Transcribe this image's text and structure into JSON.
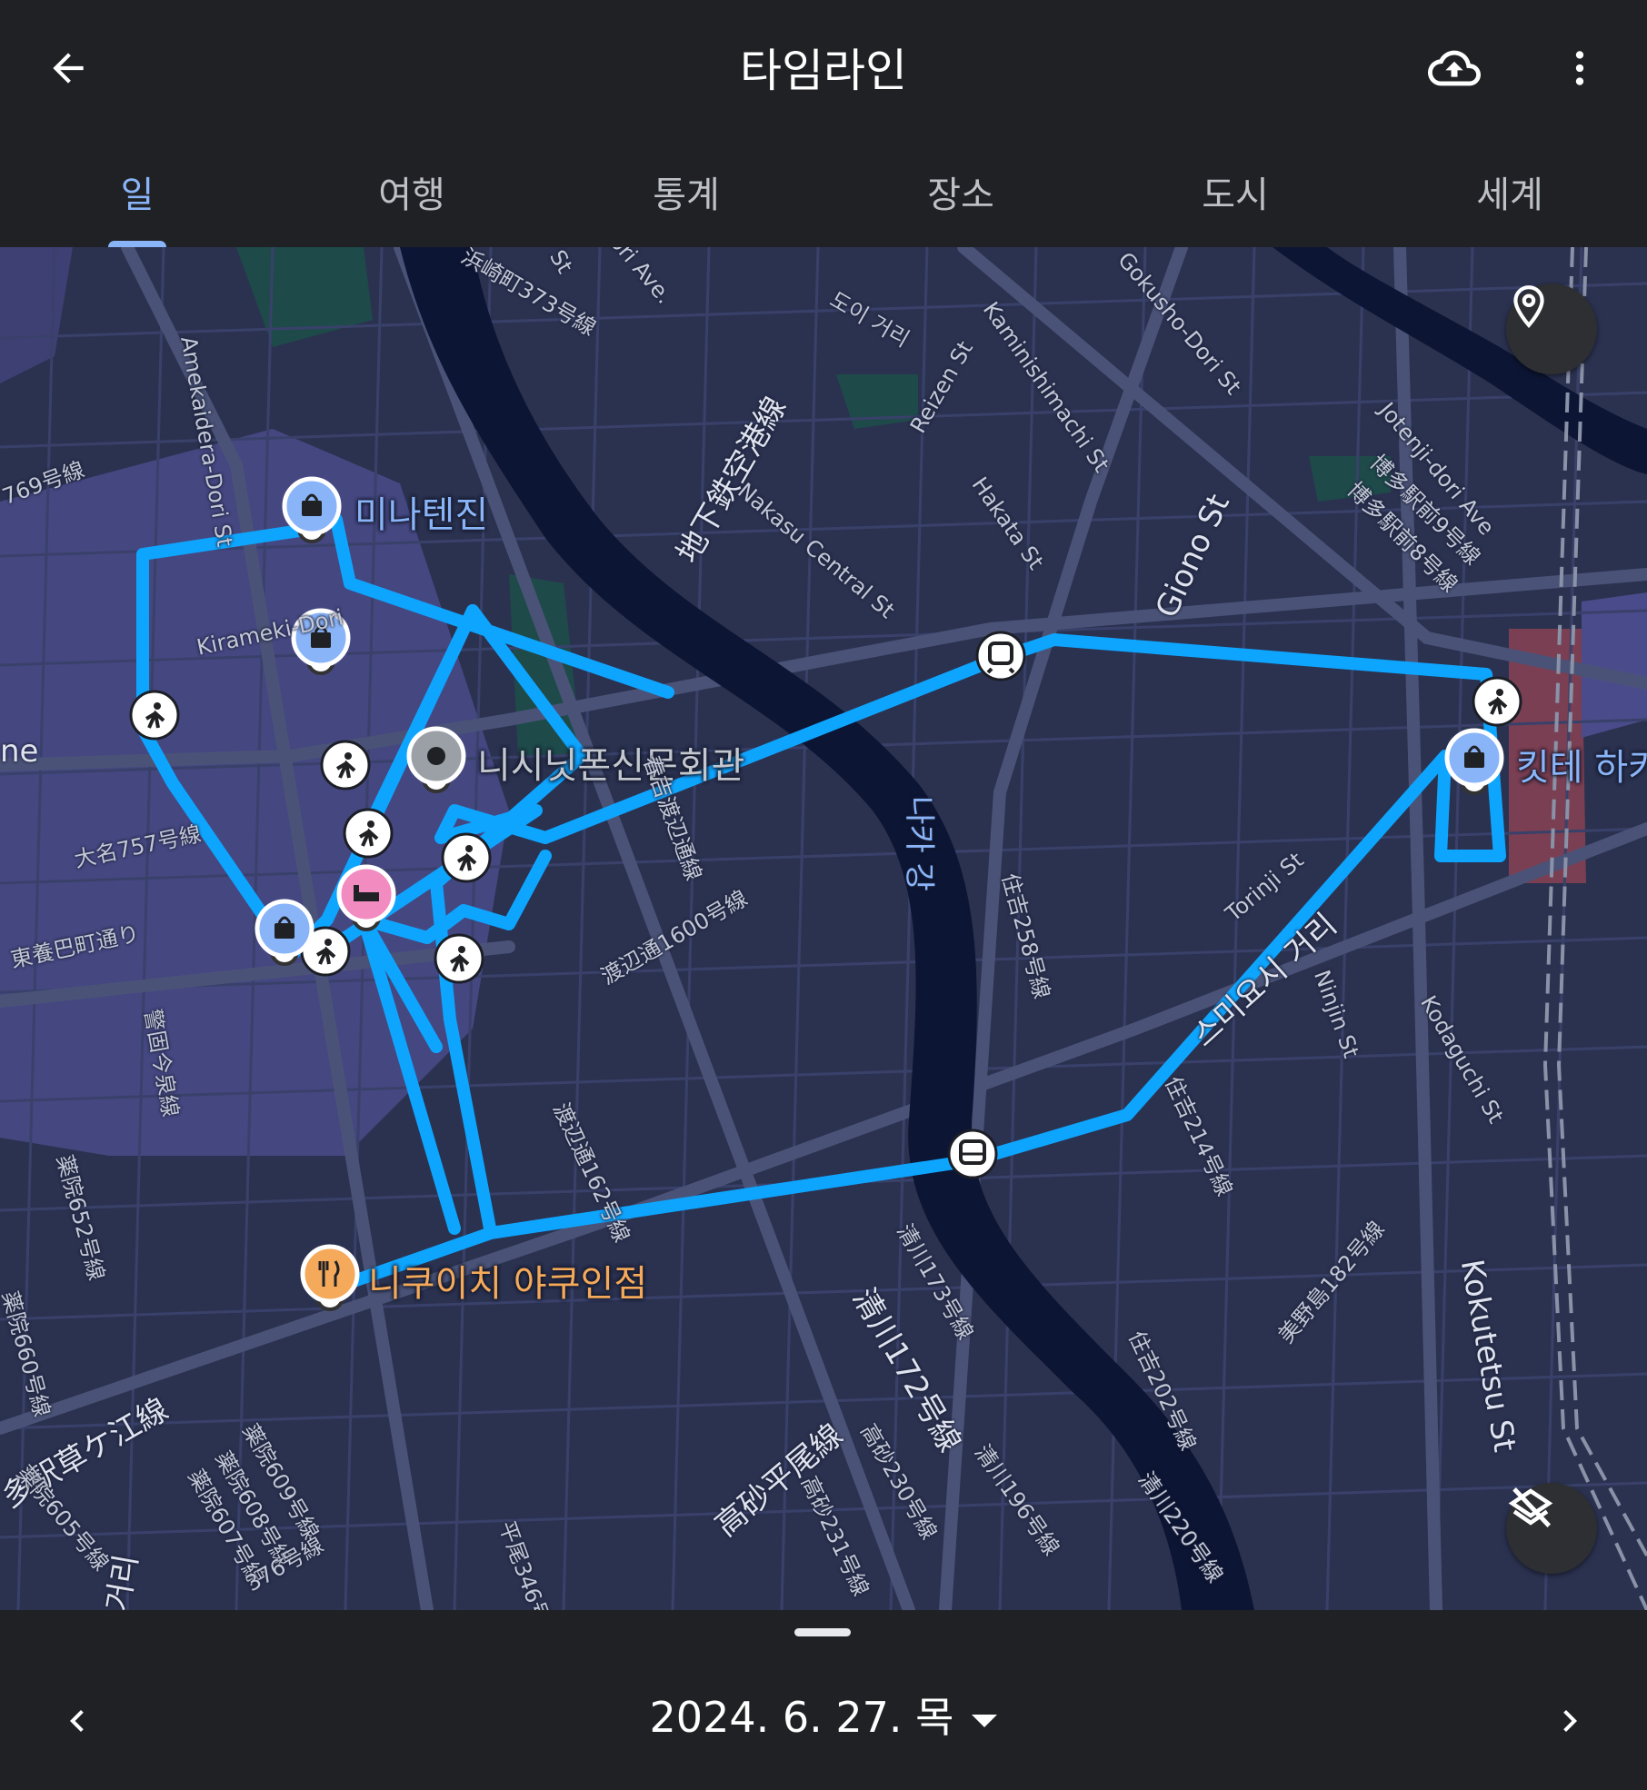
{
  "app": {
    "title": "타임라인",
    "back_icon": "arrow-back-icon",
    "upload_icon": "cloud-upload-icon",
    "menu_icon": "more-vert-icon"
  },
  "tabs": [
    {
      "label": "일",
      "active": true
    },
    {
      "label": "여행",
      "active": false
    },
    {
      "label": "통계",
      "active": false
    },
    {
      "label": "장소",
      "active": false
    },
    {
      "label": "도시",
      "active": false
    },
    {
      "label": "세계",
      "active": false
    }
  ],
  "map": {
    "places": {
      "minatenjin": "미나텐진",
      "nishinippon": "니시닛폰신문회관",
      "kitte": "킷테 하카",
      "nikuichi": "니쿠이치 야쿠인점"
    },
    "river": "나카 강",
    "streets": {
      "s1": "Amekaidera-Dori St",
      "s2": "Kirameki-Dori",
      "s3": "大名757号線",
      "s4": "東養巴町通り",
      "s5": "警固今泉線",
      "s6": "769号線",
      "s7": "地下鉄空港線",
      "s8": "도이 거리",
      "s9": "Reizen St",
      "s10": "Kaminishimachi St",
      "s11": "Hakata St",
      "s12": "Gokusho-Dori St",
      "s13": "Nakasu Central St",
      "s14": "Giono St",
      "s15": "Jotenji-dori Ave",
      "s16": "博多駅前9号線",
      "s17": "博多駅前8号線",
      "s18": "春吉渡辺通線",
      "s19": "渡辺通1600号線",
      "s20": "住吉258号線",
      "s21": "Torinji St",
      "s22": "스미요시 거리",
      "s23": "Ninjin St",
      "s24": "Kodaguchi St",
      "s25": "住吉214号線",
      "s26": "渡辺通162号線",
      "s27": "清川173号線",
      "s28": "清川172号線",
      "s29": "美野島182号線",
      "s30": "Kokutetsu St",
      "s31": "住吉202号線",
      "s32": "清川196号線",
      "s33": "清川220号線",
      "s34": "高砂平尾線",
      "s35": "高砂230号線",
      "s36": "高砂231号線",
      "s37": "平尾346号",
      "s38": "多駅草ケ江線",
      "s39": "薬院652号線",
      "s40": "薬院660号線",
      "s41": "薬院605号線",
      "s42": "薬院609号線",
      "s43": "薬院608号線",
      "s44": "薬院607号線",
      "s45": "376号線",
      "s46": "거리",
      "s47": "ne",
      "s48": "浜崎町373号線",
      "s49": "ori Ave.",
      "s50": "St"
    },
    "route_color": "#0ea5ff",
    "location_icon": "location-pin-icon",
    "layers_off_icon": "layers-off-icon"
  },
  "footer": {
    "date": "2024. 6. 27. 목",
    "prev_icon": "chevron-left-icon",
    "next_icon": "chevron-right-icon",
    "dropdown_icon": "arrow-drop-down-icon"
  }
}
